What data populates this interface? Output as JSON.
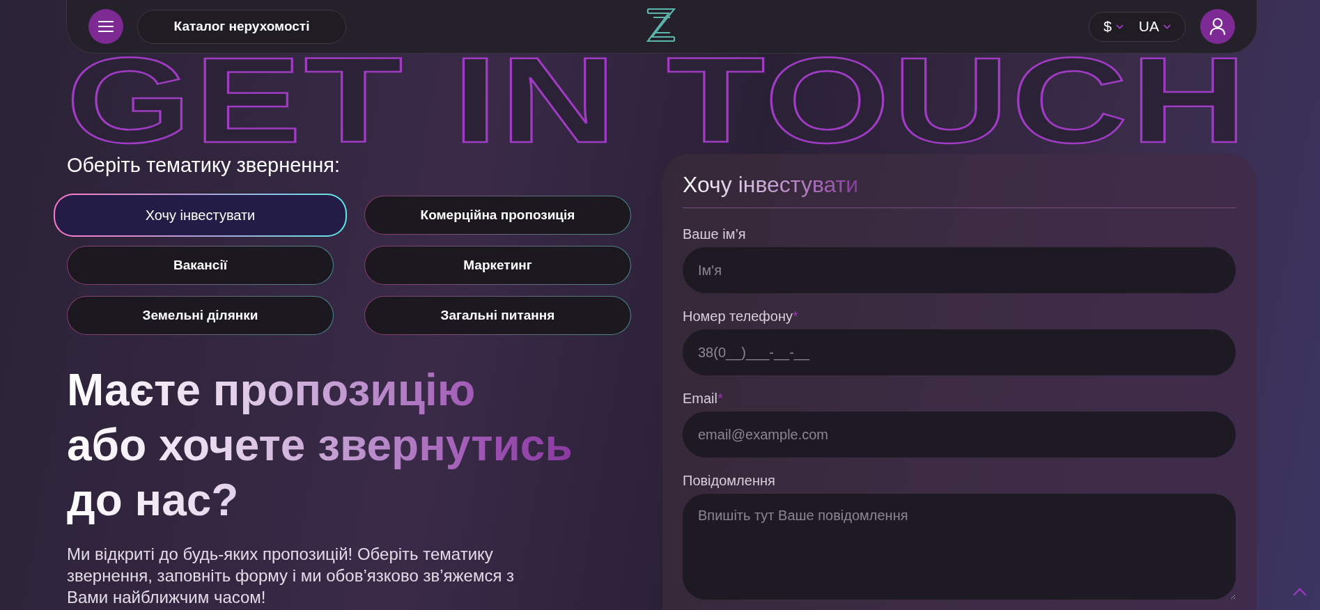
{
  "header": {
    "catalog_button": "Каталог нерухомості",
    "currency": "$",
    "language": "UA"
  },
  "background_title": "GET IN TOUCH",
  "topics": {
    "title": "Оберіть тематику звернення:",
    "items": [
      {
        "label": "Хочу інвестувати",
        "selected": true
      },
      {
        "label": "Комерційна пропозиція",
        "selected": false
      },
      {
        "label": "Вакансії",
        "selected": false
      },
      {
        "label": "Маркетинг",
        "selected": false
      },
      {
        "label": "Земельні ділянки",
        "selected": false
      },
      {
        "label": "Загальні питання",
        "selected": false
      }
    ]
  },
  "intro": {
    "heading": "Маєте пропозицію\nабо хочете звернутись\nдо нас?",
    "text": "Ми відкриті до будь-яких пропозицій! Оберіть тематику звернення, заповніть форму і ми обов’язково зв’яжемся з Вами найближчим часом!"
  },
  "form": {
    "title": "Хочу інвестувати",
    "fields": [
      {
        "kind": "input",
        "label": "Ваше ім’я",
        "placeholder": "Ім'я"
      },
      {
        "kind": "input",
        "label": "Номер телефону",
        "required_mark": "*",
        "placeholder": "38(0__)___-__-__"
      },
      {
        "kind": "input",
        "label": "Email",
        "required_mark": "*",
        "placeholder": "email@example.com"
      },
      {
        "kind": "textarea",
        "label": "Повідомлення",
        "placeholder": "Впишіть тут Ваше повідомлення"
      }
    ]
  }
}
